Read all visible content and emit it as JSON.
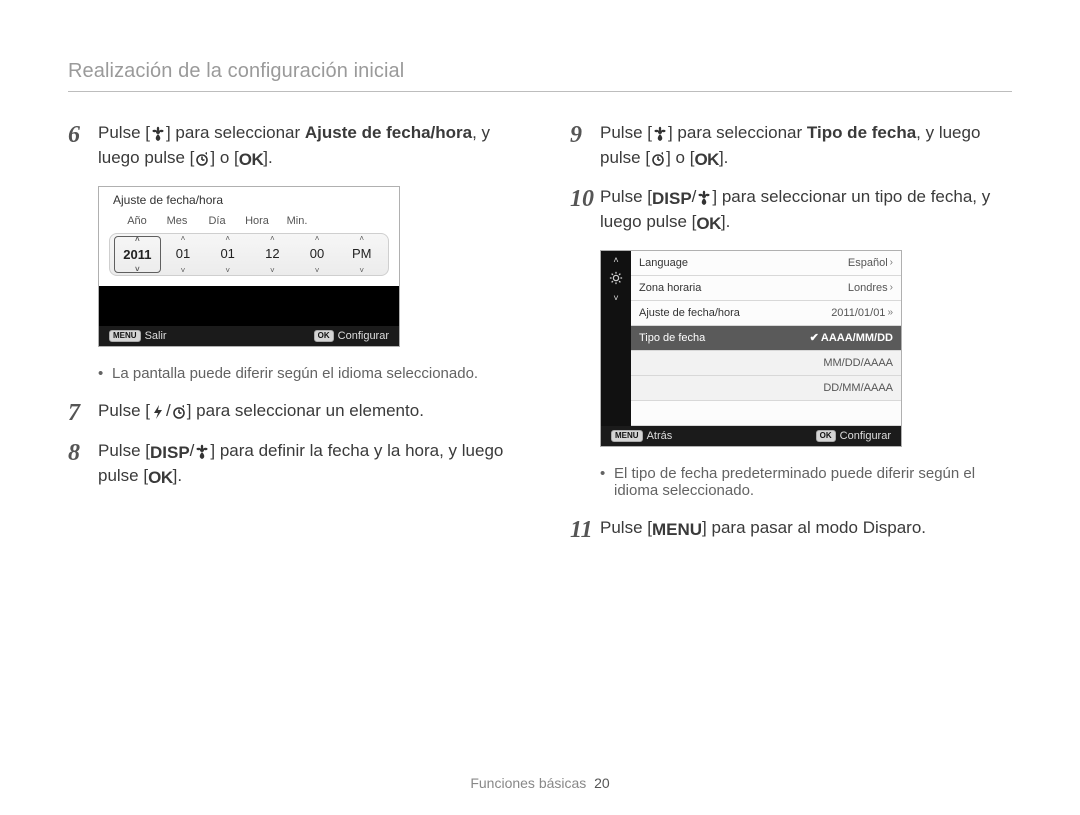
{
  "header": "Realización de la configuración inicial",
  "icons": {
    "flower": "macro-flower-icon",
    "timer": "self-timer-icon",
    "flash": "flash-icon",
    "ok": "OK",
    "disp": "DISP",
    "menu": "MENU"
  },
  "steps": {
    "s6": {
      "num": "6",
      "pre": "Pulse [",
      "afterIcon1": "] para seleccionar ",
      "bold": "Ajuste de fecha/hora",
      "mid": ", y luego pulse [",
      "orWord": "] o [",
      "end": "]."
    },
    "s7": {
      "num": "7",
      "pre": "Pulse [",
      "slash": "/",
      "after": "] para seleccionar un elemento."
    },
    "s8": {
      "num": "8",
      "pre": "Pulse [",
      "slash": "/",
      "mid": "] para definir la fecha y la hora, y luego pulse [",
      "end": "]."
    },
    "s9": {
      "num": "9",
      "pre": "Pulse [",
      "after1": "] para seleccionar ",
      "bold": "Tipo de fecha",
      "mid": ", y luego pulse [",
      "orWord": "] o [",
      "end": "]."
    },
    "s10": {
      "num": "10",
      "pre": "Pulse [",
      "slash": "/",
      "mid": "] para seleccionar un tipo de fecha, y luego pulse [",
      "end": "]."
    },
    "s11": {
      "num": "11",
      "pre": "Pulse [",
      "after": "] para pasar al modo Disparo."
    }
  },
  "notes": {
    "left": "La pantalla puede diferir según el idioma seleccionado.",
    "right": "El tipo de fecha predeterminado puede diferir según el idioma seleccionado."
  },
  "screenA": {
    "title": "Ajuste de fecha/hora",
    "labels": {
      "year": "Año",
      "month": "Mes",
      "day": "Día",
      "hour": "Hora",
      "min": "Min."
    },
    "values": {
      "year": "2011",
      "month": "01",
      "day": "01",
      "hour": "12",
      "min": "00",
      "ampm": "PM"
    },
    "footer_left_badge": "MENU",
    "footer_left": "Salir",
    "footer_right_badge": "OK",
    "footer_right": "Configurar"
  },
  "screenB": {
    "rows": {
      "lang": {
        "label": "Language",
        "value": "Español"
      },
      "zone": {
        "label": "Zona horaria",
        "value": "Londres"
      },
      "dt": {
        "label": "Ajuste de fecha/hora",
        "value": "2011/01/01"
      },
      "type": {
        "label": "Tipo de fecha",
        "value": "AAAA/MM/DD"
      },
      "opt2": {
        "value": "MM/DD/AAAA"
      },
      "opt3": {
        "value": "DD/MM/AAAA"
      }
    },
    "footer_left_badge": "MENU",
    "footer_left": "Atrás",
    "footer_right_badge": "OK",
    "footer_right": "Configurar"
  },
  "footer": {
    "section": "Funciones básicas",
    "page": "20"
  }
}
